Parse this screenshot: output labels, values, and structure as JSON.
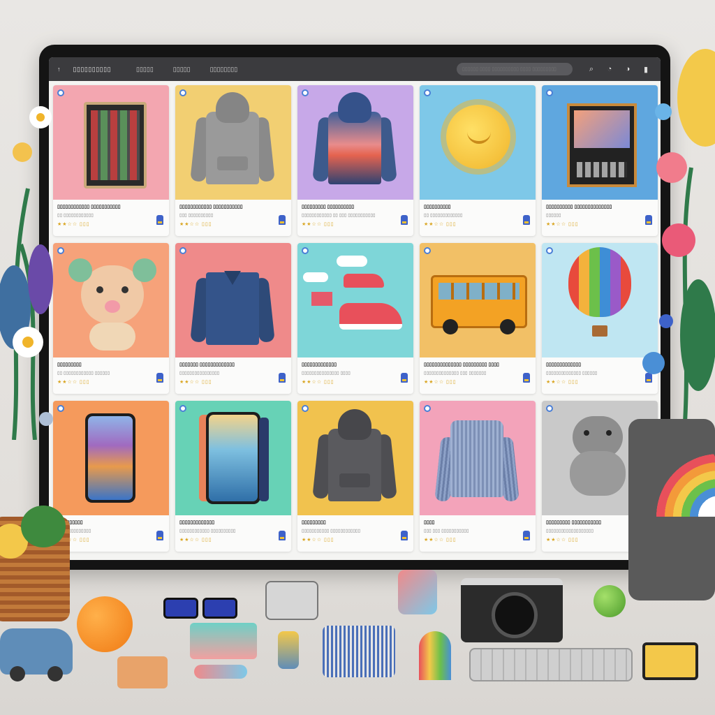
{
  "app": {
    "brand": "▯▯▯▯▯▯▯▯▯▯",
    "nav": [
      "▯▯▯▯▯",
      "▯▯▯▯▯",
      "▯▯▯▯▯▯▯▯"
    ],
    "search_placeholder": "▯▯▯▯▯▯ ▯▯▯▯ ▯▯▯▯▯▯▯▯▯▯ ▯▯▯▯ ▯▯▯▯▯▯▯▯▯",
    "icons": [
      "back-arrow-icon",
      "search-icon",
      "notification-icon",
      "user-icon",
      "menu-icon"
    ]
  },
  "products": [
    {
      "title": "▯▯▯▯▯▯▯▯▯▯▯▯ ▯▯▯▯▯▯▯▯▯▯▯",
      "sub": "▯▯ ▯▯▯▯▯▯▯▯▯▯▯▯",
      "rating": "★★☆☆ ▯▯▯",
      "image": "tablet",
      "bg": "#f3a6b0"
    },
    {
      "title": "▯▯▯▯▯▯▯▯▯▯▯▯ ▯▯▯▯▯▯▯▯▯▯▯",
      "sub": "▯▯▯ ▯▯▯▯▯▯▯▯▯▯",
      "rating": "★★☆☆ ▯▯▯",
      "image": "grey-hoodie",
      "bg": "#f2cf72"
    },
    {
      "title": "▯▯▯▯▯▯▯▯▯ ▯▯▯▯▯▯▯▯▯▯",
      "sub": "▯▯▯▯▯▯▯▯▯▯▯▯ ▯▯ ▯▯▯ ▯▯▯▯▯▯▯▯▯▯▯",
      "rating": "★★☆☆ ▯▯▯",
      "image": "sunset-hoodie",
      "bg": "#c7a8e8"
    },
    {
      "title": "▯▯▯▯▯▯▯▯▯▯",
      "sub": "▯▯ ▯▯▯▯▯▯▯▯▯▯▯▯▯",
      "rating": "★★☆☆ ▯▯▯",
      "image": "sun-toy",
      "bg": "#7ec8e8"
    },
    {
      "title": "▯▯▯▯▯▯▯▯▯▯ ▯▯▯▯▯▯▯▯▯▯▯▯▯▯",
      "sub": "▯▯▯▯▯▯",
      "rating": "★★☆☆ ▯▯▯",
      "image": "framed-art",
      "bg": "#5fa7df"
    },
    {
      "title": "▯▯▯▯▯▯▯▯▯",
      "sub": "▯▯ ▯▯▯▯▯▯▯▯▯▯▯▯ ▯▯▯▯▯▯",
      "rating": "★★☆☆ ▯▯▯",
      "image": "plush-bear",
      "bg": "#f6a27a"
    },
    {
      "title": "▯▯▯▯▯▯▯ ▯▯▯▯▯▯▯▯▯▯▯▯▯",
      "sub": "▯▯▯▯▯▯▯▯▯▯▯▯▯▯▯▯",
      "rating": "★★☆☆ ▯▯▯",
      "image": "denim-jacket",
      "bg": "#ef8a8a"
    },
    {
      "title": "▯▯▯▯▯▯▯▯▯▯▯▯▯",
      "sub": "▯▯▯▯▯▯▯▯▯▯▯▯▯▯▯ ▯▯▯▯",
      "rating": "★★☆☆ ▯▯▯",
      "image": "sneakers",
      "bg": "#7ed6d8"
    },
    {
      "title": "▯▯▯▯▯▯▯▯▯▯▯▯▯▯ ▯▯▯▯▯▯▯▯▯ ▯▯▯▯",
      "sub": "▯▯▯▯▯▯▯▯▯▯▯▯▯▯ ▯▯▯ ▯▯▯▯▯▯▯",
      "rating": "★★☆☆ ▯▯▯",
      "image": "bus-toy",
      "bg": "#f2c066"
    },
    {
      "title": "▯▯▯▯▯▯▯▯▯▯▯▯▯",
      "sub": "▯▯▯▯▯▯▯▯▯▯▯▯▯▯ ▯▯▯▯▯▯",
      "rating": "★★☆☆ ▯▯▯",
      "image": "hot-air-balloon",
      "bg": "#bfe6f2"
    },
    {
      "title": "▯▯▯ ▯▯▯▯▯▯",
      "sub": "▯▯ ▯▯▯▯▯▯▯▯▯▯▯",
      "rating": "★★☆☆ ▯▯▯",
      "image": "smartphone",
      "bg": "#f59a5c"
    },
    {
      "title": "▯▯▯▯▯▯▯▯▯▯▯▯▯",
      "sub": "▯▯▯▯▯▯▯▯▯▯▯▯ ▯▯▯▯▯▯▯▯▯▯",
      "rating": "★★☆☆ ▯▯▯",
      "image": "phones",
      "bg": "#67d2b6"
    },
    {
      "title": "▯▯▯▯▯▯▯▯▯",
      "sub": "▯▯▯▯▯▯▯▯▯▯▯ ▯▯▯▯▯▯▯▯▯▯▯▯",
      "rating": "★★☆☆ ▯▯▯",
      "image": "dark-hoodie",
      "bg": "#f1c24e"
    },
    {
      "title": "▯▯▯▯",
      "sub": "▯▯▯ ▯▯▯ ▯▯▯▯▯▯▯▯▯▯▯",
      "rating": "★★☆☆ ▯▯▯",
      "image": "striped-sweater",
      "bg": "#f3a3ba"
    },
    {
      "title": "▯▯▯▯▯▯▯▯▯ ▯▯▯▯▯▯▯▯▯▯▯",
      "sub": "▯▯▯▯▯▯▯▯▯▯▯▯▯▯▯▯▯▯▯",
      "rating": "★★☆☆ ▯▯▯",
      "image": "grey-plush",
      "bg": "#c9c9c9"
    }
  ]
}
